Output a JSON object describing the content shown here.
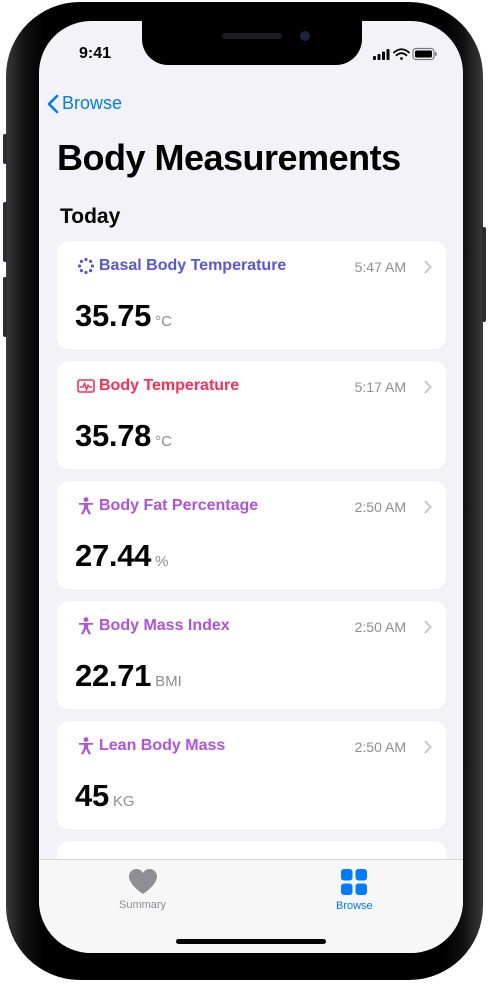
{
  "status_bar": {
    "time": "9:41"
  },
  "nav": {
    "back_label": "Browse",
    "title": "Body Measurements"
  },
  "section": {
    "label": "Today"
  },
  "colors": {
    "accent": "#007aff",
    "basal": "#5856d6",
    "temperature": "#ff2d55",
    "body": "#af52de",
    "secondary": "#8e8e93"
  },
  "cards": [
    {
      "title": "Basal Body Temperature",
      "time": "5:47 AM",
      "value": "35.75",
      "unit": "°C",
      "icon": "basal-temperature-icon"
    },
    {
      "title": "Body Temperature",
      "time": "5:17 AM",
      "value": "35.78",
      "unit": "°C",
      "icon": "thermometer-chart-icon"
    },
    {
      "title": "Body Fat Percentage",
      "time": "2:50 AM",
      "value": "27.44",
      "unit": "%",
      "icon": "person-figure-icon"
    },
    {
      "title": "Body Mass Index",
      "time": "2:50 AM",
      "value": "22.71",
      "unit": "BMI",
      "icon": "person-figure-icon"
    },
    {
      "title": "Lean Body Mass",
      "time": "2:50 AM",
      "value": "45",
      "unit": "KG",
      "icon": "person-figure-icon"
    }
  ],
  "tabbar": {
    "summary_label": "Summary",
    "browse_label": "Browse"
  }
}
